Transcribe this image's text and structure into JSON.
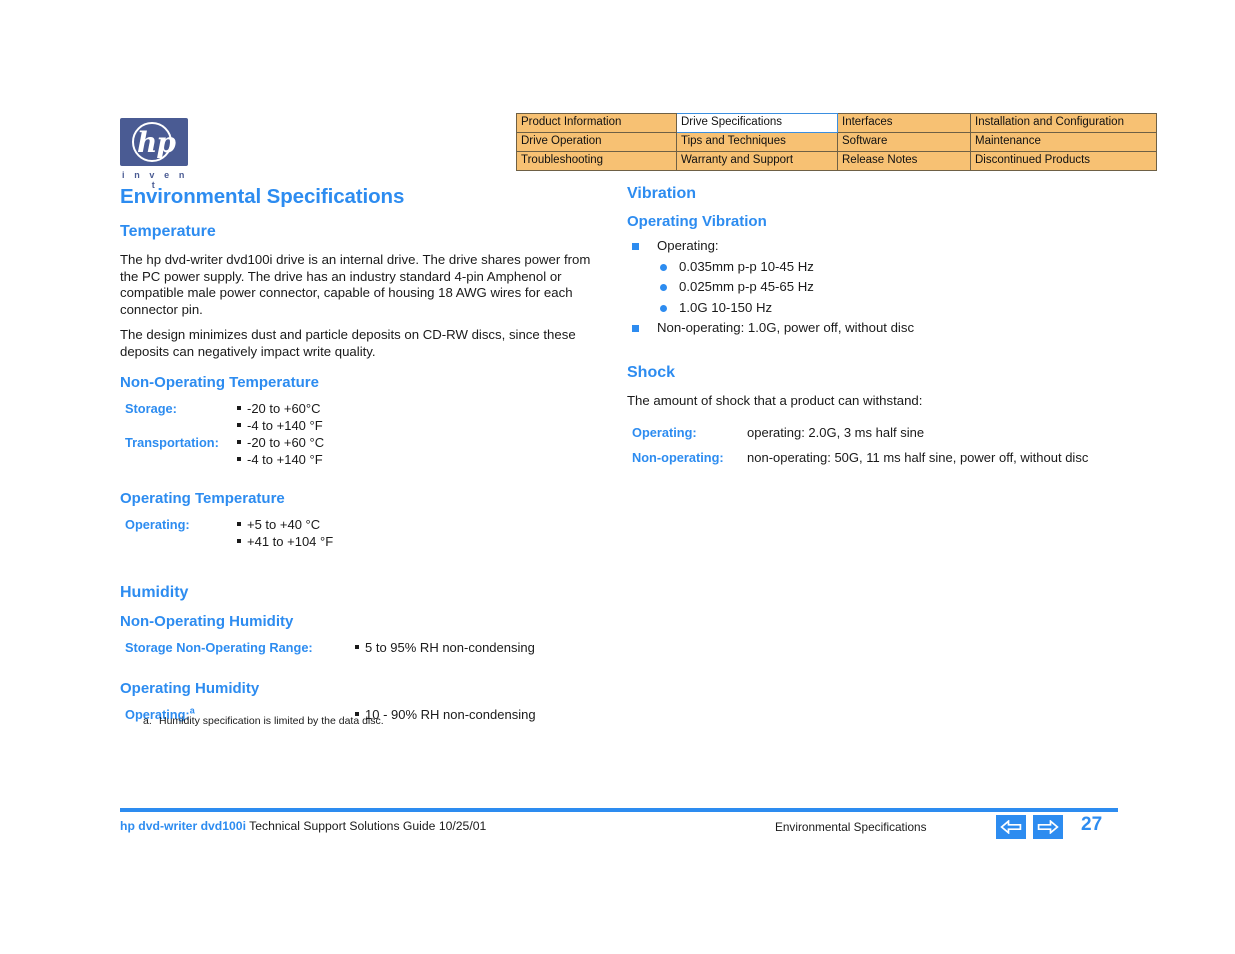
{
  "logo": {
    "mark": "hp",
    "tagline": "i n v e n t"
  },
  "nav_table": {
    "active_cell": "Drive Specifications",
    "rows": [
      [
        "Product Information",
        "Drive Specifications",
        "Interfaces",
        "Installation and Configuration"
      ],
      [
        "Drive Operation",
        "Tips and Techniques",
        "Software",
        "Maintenance"
      ],
      [
        "Troubleshooting",
        "Warranty and Support",
        "Release Notes",
        "Discontinued Products"
      ]
    ]
  },
  "left": {
    "title": "Environmental Specifications",
    "temperature": {
      "heading": "Temperature",
      "para1": "The hp dvd-writer dvd100i drive is an internal drive. The drive shares power from the PC power supply. The drive has an industry standard 4-pin Amphenol or compatible male power connector, capable of housing 18 AWG wires for each connector pin.",
      "para2": "The design minimizes dust and particle deposits on CD-RW discs, since these deposits can negatively impact write quality.",
      "non_operating": {
        "heading": "Non-Operating Temperature",
        "rows": [
          {
            "label": "Storage:",
            "values": [
              "-20 to +60°C",
              "-4 to +140 °F"
            ]
          },
          {
            "label": "Transportation:",
            "values": [
              "-20 to +60 °C",
              "-4 to +140 °F"
            ]
          }
        ]
      },
      "operating": {
        "heading": "Operating Temperature",
        "rows": [
          {
            "label": "Operating:",
            "values": [
              "+5 to +40 °C",
              "+41 to +104 °F"
            ]
          }
        ]
      }
    },
    "humidity": {
      "heading": "Humidity",
      "non_operating": {
        "heading": "Non-Operating Humidity",
        "rows": [
          {
            "label": "Storage Non-Operating Range:",
            "values": [
              "5 to 95% RH non-condensing"
            ]
          }
        ]
      },
      "operating": {
        "heading": "Operating Humidity",
        "rows": [
          {
            "label": "Operating:",
            "footnote_marker": "a",
            "values": [
              "10 - 90% RH non-condensing"
            ]
          }
        ]
      }
    },
    "footnote": {
      "marker": "a.",
      "text": "Humidity specification is limited by the data disc."
    }
  },
  "right": {
    "vibration": {
      "heading": "Vibration",
      "operating": {
        "heading": "Operating Vibration",
        "item1": "Operating:",
        "subitems": [
          "0.035mm p-p 10-45 Hz",
          "0.025mm p-p 45-65 Hz",
          "1.0G 10-150 Hz"
        ],
        "item2": "Non-operating: 1.0G, power off, without disc"
      }
    },
    "shock": {
      "heading": "Shock",
      "intro": "The amount of shock that a product can withstand:",
      "rows": [
        {
          "label": "Operating:",
          "value": "operating: 2.0G, 3 ms half sine"
        },
        {
          "label": "Non-operating:",
          "value": "non-operating: 50G, 11 ms half sine, power off, without disc"
        }
      ]
    }
  },
  "footer": {
    "brand": "hp dvd-writer  dvd100i",
    "guide": " Technical Support Solutions Guide 10/25/01",
    "section": "Environmental Specifications",
    "page_number": "27",
    "prev_label": "⇐",
    "next_label": "⇒"
  },
  "colors": {
    "accent_blue": "#2d8cf0",
    "table_amber": "#f7c173",
    "logo_blue": "#4a5b93"
  }
}
